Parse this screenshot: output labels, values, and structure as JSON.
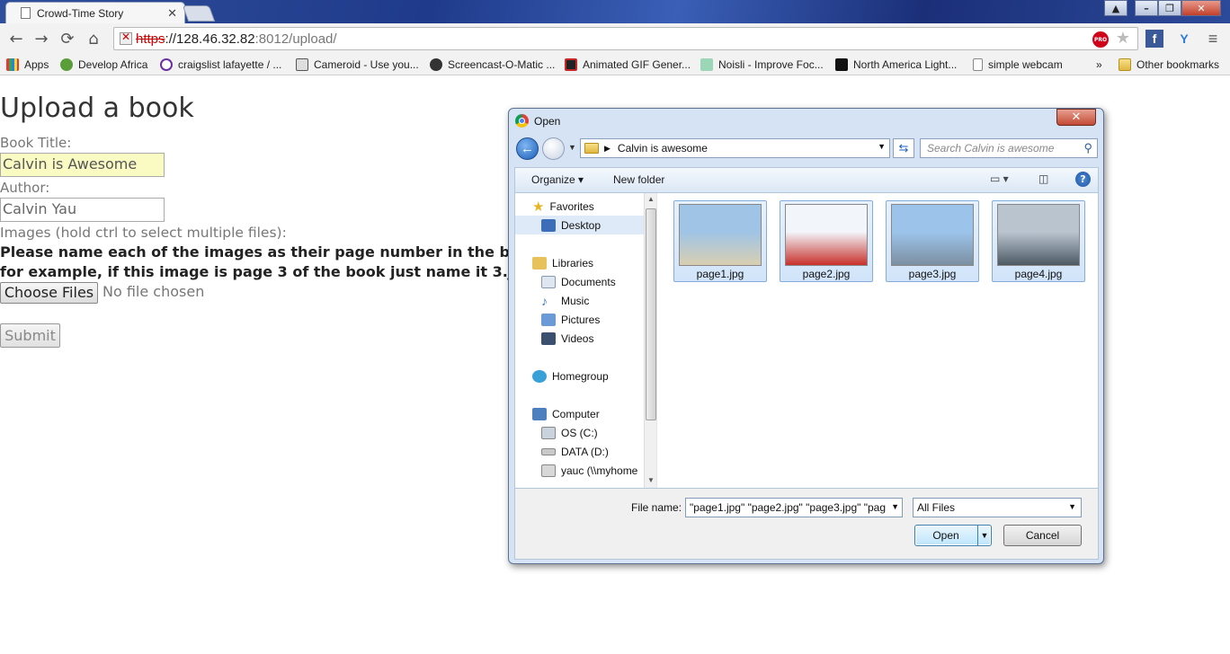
{
  "browser": {
    "tab_title": "Crowd-Time Story",
    "tab_close": "✕",
    "url_scheme": "https",
    "url_host": "://128.46.32.82",
    "url_path": ":8012/upload/",
    "win_buttons": [
      "▲",
      "–",
      "❐",
      "✕"
    ],
    "pro_badge": "PRO",
    "ext_fb": "f",
    "ext_y": "Y",
    "menu": "≡"
  },
  "bookmarks": {
    "items": [
      "Apps",
      "Develop Africa",
      "craigslist lafayette / ...",
      "Cameroid - Use you...",
      "Screencast-O-Matic ...",
      "Animated GIF Gener...",
      "Noisli - Improve Foc...",
      "North America Light...",
      "simple webcam"
    ],
    "overflow": "»",
    "other": "Other bookmarks"
  },
  "page": {
    "heading": "Upload a book",
    "title_label": "Book Title:",
    "title_value": "Calvin is Awesome",
    "author_label": "Author:",
    "author_value": "Calvin Yau",
    "images_label": "Images (hold ctrl to select multiple files):",
    "note_line1": "Please name each of the images as their page number in the book,",
    "note_line2": "for example, if this image is page 3 of the book just name it 3.jpg",
    "choose_label": "Choose Files",
    "no_file": "No file chosen",
    "submit_label": "Submit"
  },
  "dialog": {
    "title": "Open",
    "close": "✕",
    "breadcrumb": "Calvin is awesome",
    "search_placeholder": "Search Calvin is awesome",
    "organize": "Organize ▾",
    "new_folder": "New folder",
    "help": "?",
    "nav": [
      {
        "label": "Favorites",
        "color": "#f3c33a"
      },
      {
        "label": "Desktop",
        "color": "#3c6eb8"
      },
      {
        "label": "Libraries",
        "color": "#e7c259"
      },
      {
        "label": "Documents",
        "color": "#dfe6ef"
      },
      {
        "label": "Music",
        "color": "#3a78c8"
      },
      {
        "label": "Pictures",
        "color": "#6b9ad6"
      },
      {
        "label": "Videos",
        "color": "#3b4f6e"
      },
      {
        "label": "Homegroup",
        "color": "#3aa0d8"
      },
      {
        "label": "Computer",
        "color": "#4d7fbf"
      },
      {
        "label": "OS (C:)",
        "color": "#c9d3de"
      },
      {
        "label": "DATA (D:)",
        "color": "#c9c9c9"
      },
      {
        "label": "yauc (\\\\myhome",
        "color": "#d8d8d8"
      }
    ],
    "files": [
      {
        "name": "page1.jpg",
        "colors": [
          "#9fc4e6",
          "#d9cfb2"
        ]
      },
      {
        "name": "page2.jpg",
        "colors": [
          "#f2f5fa",
          "#c8312d"
        ]
      },
      {
        "name": "page3.jpg",
        "colors": [
          "#9cc4ea",
          "#7c8fa1"
        ]
      },
      {
        "name": "page4.jpg",
        "colors": [
          "#b9c4cf",
          "#4d5a64"
        ]
      }
    ],
    "filename_label": "File name:",
    "filename_value": "\"page1.jpg\" \"page2.jpg\" \"page3.jpg\" \"pag",
    "filter": "All Files",
    "open_label": "Open",
    "cancel_label": "Cancel"
  }
}
